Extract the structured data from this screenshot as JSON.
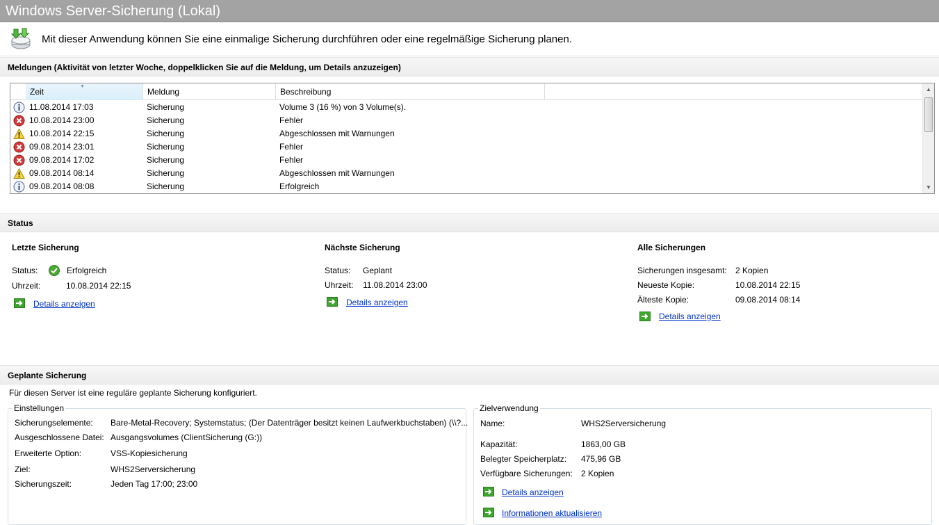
{
  "window": {
    "title": "Windows Server-Sicherung (Lokal)"
  },
  "intro": {
    "text": "Mit dieser Anwendung können Sie eine einmalige Sicherung durchführen oder eine regelmäßige Sicherung planen.",
    "icon": "backup-app-icon"
  },
  "messages": {
    "header": "Meldungen (Aktivität von letzter Woche, doppelklicken Sie auf die Meldung, um Details anzuzeigen)",
    "columns": {
      "time": "Zeit",
      "message": "Meldung",
      "description": "Beschreibung"
    },
    "rows": [
      {
        "icon": "info-icon",
        "time": "11.08.2014 17:03",
        "message": "Sicherung",
        "description": "Volume 3 (16 %) von 3 Volume(s)."
      },
      {
        "icon": "error-icon",
        "time": "10.08.2014 23:00",
        "message": "Sicherung",
        "description": "Fehler"
      },
      {
        "icon": "warning-icon",
        "time": "10.08.2014 22:15",
        "message": "Sicherung",
        "description": "Abgeschlossen mit Warnungen"
      },
      {
        "icon": "error-icon",
        "time": "09.08.2014 23:01",
        "message": "Sicherung",
        "description": "Fehler"
      },
      {
        "icon": "error-icon",
        "time": "09.08.2014 17:02",
        "message": "Sicherung",
        "description": "Fehler"
      },
      {
        "icon": "warning-icon",
        "time": "09.08.2014 08:14",
        "message": "Sicherung",
        "description": "Abgeschlossen mit Warnungen"
      },
      {
        "icon": "info-icon",
        "time": "09.08.2014 08:08",
        "message": "Sicherung",
        "description": "Erfolgreich"
      }
    ]
  },
  "status": {
    "header": "Status",
    "last": {
      "title": "Letzte Sicherung",
      "status_label": "Status:",
      "status_value": "Erfolgreich",
      "time_label": "Uhrzeit:",
      "time_value": "10.08.2014 22:15",
      "link": "Details anzeigen"
    },
    "next": {
      "title": "Nächste Sicherung",
      "status_label": "Status:",
      "status_value": "Geplant",
      "time_label": "Uhrzeit:",
      "time_value": "11.08.2014 23:00",
      "link": "Details anzeigen"
    },
    "all": {
      "title": "Alle Sicherungen",
      "total_label": "Sicherungen insgesamt:",
      "total_value": "2 Kopien",
      "newest_label": "Neueste Kopie:",
      "newest_value": "10.08.2014 22:15",
      "oldest_label": "Älteste Kopie:",
      "oldest_value": "09.08.2014 08:14",
      "link": "Details anzeigen"
    }
  },
  "scheduled": {
    "header": "Geplante Sicherung",
    "intro": "Für diesen Server ist eine reguläre geplante Sicherung konfiguriert.",
    "settings": {
      "legend": "Einstellungen",
      "items_label": "Sicherungselemente:",
      "items_value": "Bare-Metal-Recovery; Systemstatus; (Der Datenträger besitzt keinen Laufwerkbuchstaben) (\\\\?...",
      "excluded_label": "Ausgeschlossene Datei:",
      "excluded_value": "Ausgangsvolumes (ClientSicherung (G:))",
      "advanced_label": "Erweiterte Option:",
      "advanced_value": "VSS-Kopiesicherung",
      "target_label": "Ziel:",
      "target_value": "WHS2Serversicherung",
      "time_label": "Sicherungszeit:",
      "time_value": "Jeden Tag 17:00; 23:00"
    },
    "target": {
      "legend": "Zielverwendung",
      "name_label": "Name:",
      "name_value": "WHS2Serversicherung",
      "capacity_label": "Kapazität:",
      "capacity_value": "1863,00 GB",
      "used_label": "Belegter Speicherplatz:",
      "used_value": "475,96 GB",
      "available_label": "Verfügbare Sicherungen:",
      "available_value": "2 Kopien",
      "details_link": "Details anzeigen",
      "refresh_link": "Informationen aktualisieren"
    }
  }
}
